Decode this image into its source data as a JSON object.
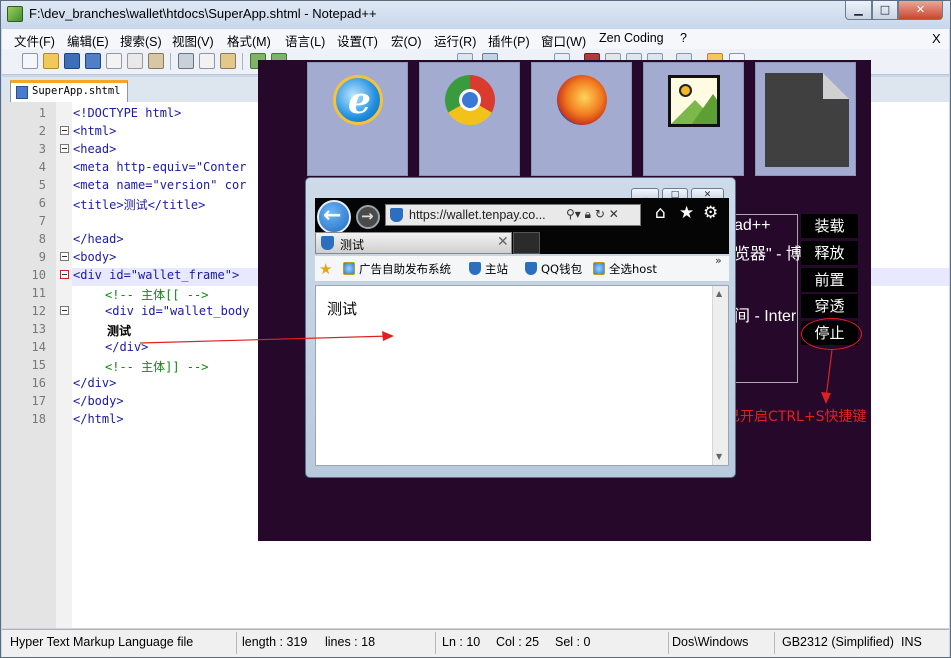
{
  "window": {
    "title": "F:\\dev_branches\\wallet\\htdocs\\SuperApp.shtml - Notepad++",
    "minimize_icon": "minimize-icon",
    "maximize_icon": "maximize-icon",
    "close_icon": "close-icon"
  },
  "menu": {
    "items": [
      "文件(F)",
      "编辑(E)",
      "搜索(S)",
      "视图(V)",
      "格式(M)",
      "语言(L)",
      "设置(T)",
      "宏(O)",
      "运行(R)",
      "插件(P)",
      "窗口(W)",
      "Zen Coding",
      "?"
    ],
    "close_x": "X"
  },
  "tabs": {
    "active_file": "SuperApp.shtml"
  },
  "editor": {
    "lines": [
      {
        "n": "1",
        "text": "<!DOCTYPE html>"
      },
      {
        "n": "2",
        "text": "<html>"
      },
      {
        "n": "3",
        "text": "<head>"
      },
      {
        "n": "4",
        "text": "<meta http-equiv=\"Conter"
      },
      {
        "n": "5",
        "text": "<meta name=\"version\" cor"
      },
      {
        "n": "6",
        "text": "<title>测试</title>"
      },
      {
        "n": "7",
        "text": ""
      },
      {
        "n": "8",
        "text": "</head>"
      },
      {
        "n": "9",
        "text": "<body>"
      },
      {
        "n": "10",
        "text": "<div id=\"wallet_frame\">"
      },
      {
        "n": "11",
        "text": "<!-- 主体[[ -->"
      },
      {
        "n": "12",
        "text": "<div id=\"wallet_body"
      },
      {
        "n": "13",
        "text": "测试"
      },
      {
        "n": "14",
        "text": "</div>"
      },
      {
        "n": "15",
        "text": "<!-- 主体]] -->"
      },
      {
        "n": "16",
        "text": "</div>"
      },
      {
        "n": "17",
        "text": "</body>"
      },
      {
        "n": "18",
        "text": "</html>"
      }
    ]
  },
  "statusbar": {
    "filetype": "Hyper Text Markup Language file",
    "length": "length : 319",
    "lines": "lines : 18",
    "ln": "Ln : 10",
    "col": "Col : 25",
    "sel": "Sel : 0",
    "eol": "Dos\\Windows",
    "encoding": "GB2312 (Simplified)",
    "mode": "INS"
  },
  "superapp": {
    "launchers": [
      {
        "name": "ie",
        "icon": "internet-explorer-icon"
      },
      {
        "name": "chrome",
        "icon": "chrome-icon"
      },
      {
        "name": "firefox",
        "icon": "firefox-icon"
      },
      {
        "name": "image",
        "icon": "image-icon"
      },
      {
        "name": "document",
        "icon": "document-icon"
      }
    ],
    "ghost_texts": [
      "ad++",
      "览器\" - 博",
      "间 - Inter"
    ],
    "controls": [
      "装载",
      "释放",
      "前置",
      "穿透",
      "停止"
    ],
    "hint": "已开启CTRL+S快捷键",
    "accent_color": "#e02020",
    "background": "#26092a"
  },
  "ie": {
    "url": "https://wallet.tenpay.co...",
    "tab_title": "测试",
    "favorites": [
      "广告自助发布系统",
      "主站",
      "QQ钱包",
      "全选host"
    ],
    "page_text": "测试"
  }
}
